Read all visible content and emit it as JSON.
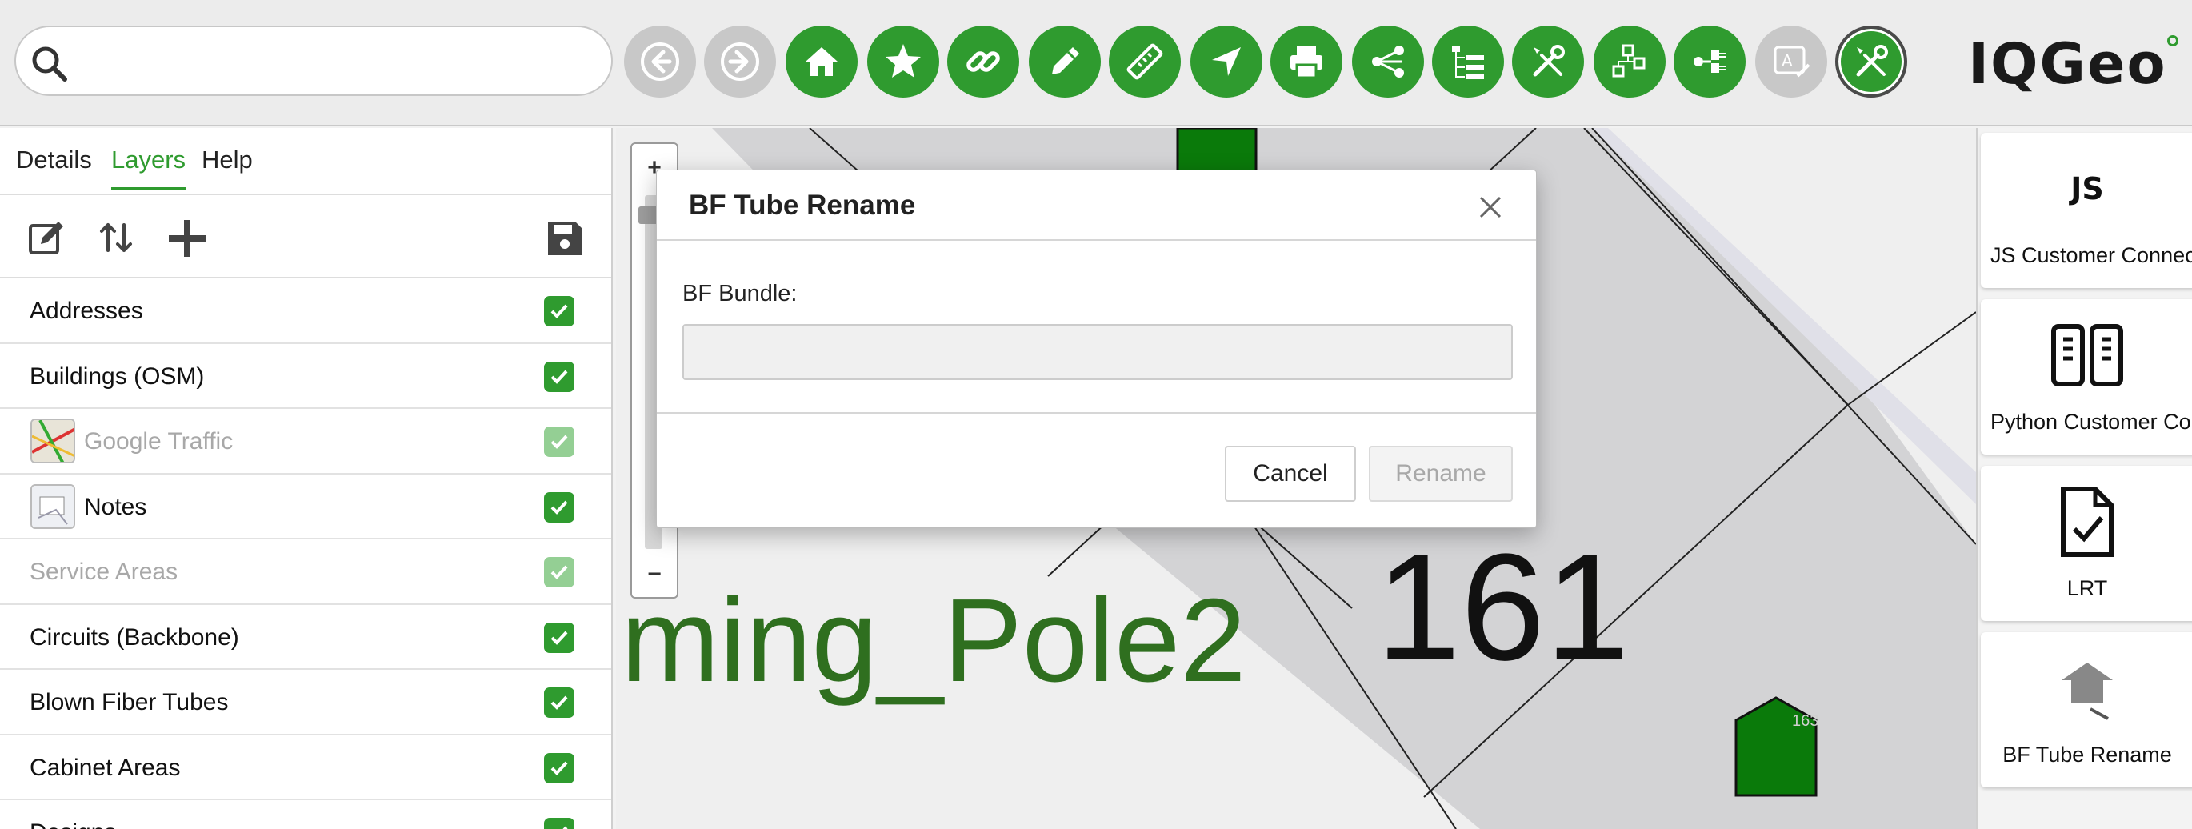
{
  "search": {
    "placeholder": "",
    "value": ""
  },
  "toolbar": {
    "buttons": [
      {
        "icon": "back-arrow-icon",
        "state": "disabled"
      },
      {
        "icon": "forward-arrow-icon",
        "state": "disabled"
      },
      {
        "icon": "home-icon",
        "state": "enabled"
      },
      {
        "icon": "star-icon",
        "state": "enabled"
      },
      {
        "icon": "link-icon",
        "state": "enabled"
      },
      {
        "icon": "pencil-icon",
        "state": "enabled"
      },
      {
        "icon": "ruler-icon",
        "state": "enabled"
      },
      {
        "icon": "navigate-icon",
        "state": "enabled"
      },
      {
        "icon": "printer-icon",
        "state": "enabled"
      },
      {
        "icon": "share-icon",
        "state": "enabled"
      },
      {
        "icon": "tree-list-icon",
        "state": "enabled"
      },
      {
        "icon": "tools-icon",
        "state": "enabled"
      },
      {
        "icon": "network-icon",
        "state": "enabled"
      },
      {
        "icon": "plug-connect-icon",
        "state": "enabled"
      },
      {
        "icon": "label-edit-icon",
        "state": "disabled"
      },
      {
        "icon": "tools-icon",
        "state": "active"
      }
    ],
    "colors": {
      "accent": "#2f9b2f",
      "disabled": "#c8c8c8"
    }
  },
  "logo": {
    "text": "IQGeo"
  },
  "left_panel": {
    "tabs": [
      {
        "label": "Details",
        "selected": false
      },
      {
        "label": "Layers",
        "selected": true
      },
      {
        "label": "Help",
        "selected": false
      }
    ],
    "tools": [
      "edit-icon",
      "sort-icon",
      "add-icon",
      "save-icon"
    ],
    "layers": [
      {
        "name": "Addresses",
        "checked": true,
        "dimmed": false,
        "thumbnail": false
      },
      {
        "name": "Buildings (OSM)",
        "checked": true,
        "dimmed": false,
        "thumbnail": false
      },
      {
        "name": "Google Traffic",
        "checked": true,
        "dimmed": true,
        "thumbnail": true
      },
      {
        "name": "Notes",
        "checked": true,
        "dimmed": false,
        "thumbnail": true
      },
      {
        "name": "Service Areas",
        "checked": true,
        "dimmed": true,
        "thumbnail": false
      },
      {
        "name": "Circuits (Backbone)",
        "checked": true,
        "dimmed": false,
        "thumbnail": false
      },
      {
        "name": "Blown Fiber Tubes",
        "checked": true,
        "dimmed": false,
        "thumbnail": false
      },
      {
        "name": "Cabinet Areas",
        "checked": true,
        "dimmed": false,
        "thumbnail": false
      },
      {
        "name": "Designs",
        "checked": true,
        "dimmed": false,
        "thumbnail": false
      }
    ]
  },
  "map": {
    "zoom_in_label": "+",
    "zoom_out_label": "−",
    "labels": {
      "pole": "ming_Pole2",
      "number_161": "161",
      "number_163": "163"
    }
  },
  "right_panel": {
    "apps": [
      {
        "label": "JS Customer Connection",
        "icon": "js-icon"
      },
      {
        "label": "Python Customer Connection",
        "icon": "columns-icon"
      },
      {
        "label": "LRT",
        "icon": "document-check-icon"
      },
      {
        "label": "BF Tube Rename",
        "icon": "bf-tube-rename-icon"
      }
    ]
  },
  "dialog": {
    "title": "BF Tube Rename",
    "field_label": "BF Bundle:",
    "field_value": "",
    "cancel_label": "Cancel",
    "rename_label": "Rename"
  }
}
